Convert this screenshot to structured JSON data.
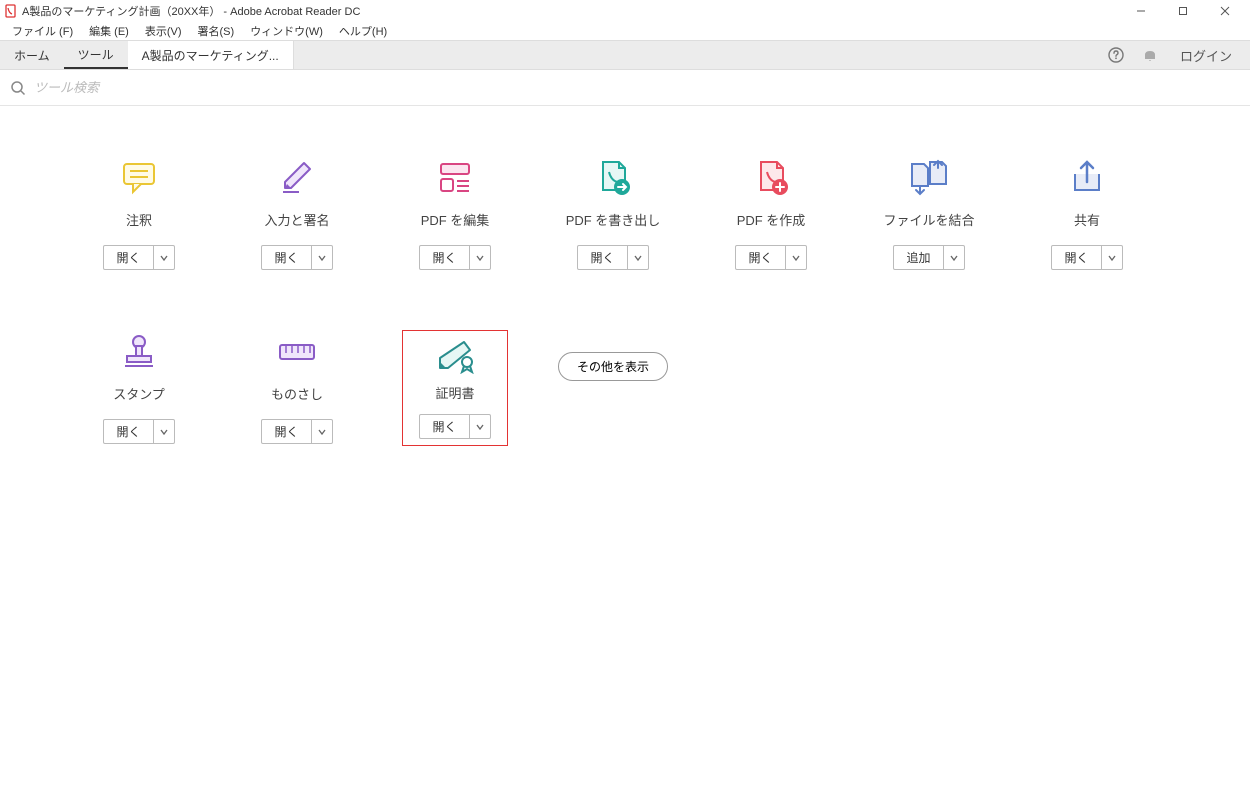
{
  "window": {
    "title": "A製品のマーケティング計画（20XX年）  - Adobe Acrobat Reader DC"
  },
  "menu": {
    "file": "ファイル (F)",
    "edit": "編集 (E)",
    "view": "表示(V)",
    "sign": "署名(S)",
    "window": "ウィンドウ(W)",
    "help": "ヘルプ(H)"
  },
  "tabs": {
    "home": "ホーム",
    "tools": "ツール",
    "doc": "A製品のマーケティング..."
  },
  "top_right": {
    "login": "ログイン"
  },
  "search": {
    "placeholder": "ツール検索"
  },
  "tools": {
    "comment": {
      "label": "注釈",
      "btn": "開く"
    },
    "fillsign": {
      "label": "入力と署名",
      "btn": "開く"
    },
    "editpdf": {
      "label": "PDF を編集",
      "btn": "開く"
    },
    "exportpdf": {
      "label": "PDF を書き出し",
      "btn": "開く"
    },
    "createpdf": {
      "label": "PDF を作成",
      "btn": "開く"
    },
    "combine": {
      "label": "ファイルを結合",
      "btn": "追加"
    },
    "share": {
      "label": "共有",
      "btn": "開く"
    },
    "stamp": {
      "label": "スタンプ",
      "btn": "開く"
    },
    "measure": {
      "label": "ものさし",
      "btn": "開く"
    },
    "certificate": {
      "label": "証明書",
      "btn": "開く"
    }
  },
  "showmore": "その他を表示",
  "colors": {
    "yellow": "#eac634",
    "purple": "#8a5cc6",
    "magenta": "#d94582",
    "teal": "#1fa89a",
    "redpink": "#e84c5e",
    "blue": "#5b7ec8",
    "darkteal": "#2a8e8e",
    "boxred": "#e33333"
  }
}
